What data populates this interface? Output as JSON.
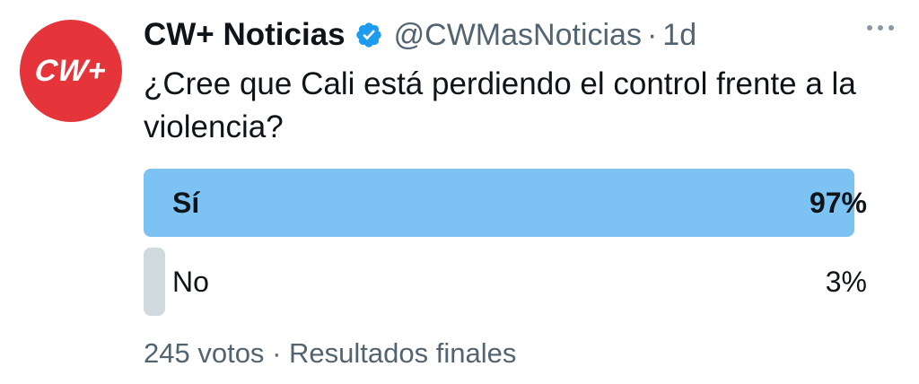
{
  "author": {
    "avatar_text": "CW+",
    "display_name": "CW+ Noticias",
    "verified_icon": "verified-badge-icon",
    "handle": "@CWMasNoticias",
    "separator": "·",
    "time": "1d"
  },
  "tweet": {
    "text": "¿Cree que Cali está perdiendo el control frente a la violencia?"
  },
  "poll": {
    "options": [
      {
        "label": "Sí",
        "percent_text": "97%",
        "percent": 97,
        "winner": true
      },
      {
        "label": "No",
        "percent_text": "3%",
        "percent": 3,
        "winner": false
      }
    ],
    "votes": "245 votos",
    "separator": "·",
    "status": "Resultados finales"
  },
  "colors": {
    "avatar_bg": "#e5353b",
    "winner_bar": "#7cc3f4",
    "loser_bar": "#cfd9de",
    "verified": "#1d9bf0",
    "muted_text": "#536471"
  }
}
